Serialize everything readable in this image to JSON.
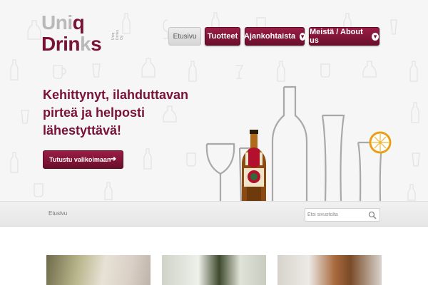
{
  "logo": {
    "line1_gray": "Uni",
    "line1_dark": "q",
    "line2_dark": "Drin",
    "line2_gray": "k",
    "line2_dark_end": "s",
    "subtitle": "Uniq Drinks Oy"
  },
  "nav": {
    "home": "Etusivu",
    "products": "Tuotteet",
    "news": "Ajankohtaista",
    "about": "Meistä / About us"
  },
  "hero": {
    "headline": [
      "Kehittynyt, ilahduttavan",
      "pirteä ja helposti",
      "lähestyttävä!"
    ],
    "cta_label": "Tutustu valikoimaan"
  },
  "breadcrumb": "Etusivu",
  "search": {
    "placeholder": "Etsi sivustolta",
    "value": ""
  },
  "colors": {
    "accent": "#7a1238",
    "logo_gray": "#b9b9b9",
    "hero_bg": "#f6f6f6"
  },
  "icons": {
    "search": "search-icon",
    "arrow": "arrow-right-icon",
    "dropdown": "chevron-down-icon"
  }
}
